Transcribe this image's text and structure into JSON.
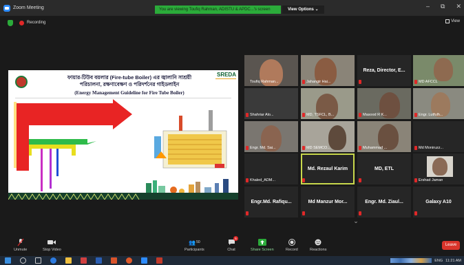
{
  "window": {
    "title": "Zoom Meeting",
    "viewing_text": "You are viewing Toufiq Rahman, ADISTU & APDC...'s screen",
    "view_options_label": "View Options ⌄",
    "view_label": "View"
  },
  "status": {
    "recording_label": "Recording"
  },
  "slide": {
    "title_bn": "ফায়ার-টিউব বয়লার (Fire-tube Boiler) এর জ্বালানি সাশ্রয়ী",
    "title_bn_2": "পরিচালনা, রক্ষণাবেক্ষণ ও পরিদর্শনের গাইডলাইন",
    "title_en": "(Energy Management Guideline for Fire Tube Boiler)",
    "logo_text": "SREDA"
  },
  "participants": [
    {
      "name": "Toufiq Rahman..."
    },
    {
      "name": "Jahangir Hai..."
    },
    {
      "name": "Reza, Director, E..."
    },
    {
      "name": "MD AFCCL"
    },
    {
      "name": "Shahriar Alo..."
    },
    {
      "name": "MD, TSFCL, B..."
    },
    {
      "name": "Masood R K..."
    },
    {
      "name": "Engr. Lutfulh..."
    },
    {
      "name": "Engr. Md. Sai..."
    },
    {
      "name": "MD SEMCO..."
    },
    {
      "name": "Muhammad ..."
    },
    {
      "name": "Md Moniruzz..."
    },
    {
      "name": "Khaled_ADM..."
    },
    {
      "name": "Md. Rezaul Karim"
    },
    {
      "name": "MD, ETL"
    },
    {
      "name": "Ershad Jaman"
    },
    {
      "name": "Engr.Md. Rafiqu..."
    },
    {
      "name": "Md Manzur Mor..."
    },
    {
      "name": "Engr. Md. Ziaul..."
    },
    {
      "name": "Galaxy A10"
    }
  ],
  "toolbar": {
    "unmute": "Unmute",
    "stop_video": "Stop Video",
    "participants_label": "Participants",
    "participants_count": "50",
    "chat": "Chat",
    "chat_badge": "5",
    "share_screen": "Share Screen",
    "record": "Record",
    "reactions": "Reactions",
    "leave": "Leave"
  },
  "taskbar": {
    "lang": "ENG",
    "time": "11:21 AM"
  },
  "colors": {
    "zoom_blue": "#2d8cff",
    "share_green": "#2bab3a",
    "leave_red": "#d9342b",
    "active_speaker": "#c9d94c"
  }
}
